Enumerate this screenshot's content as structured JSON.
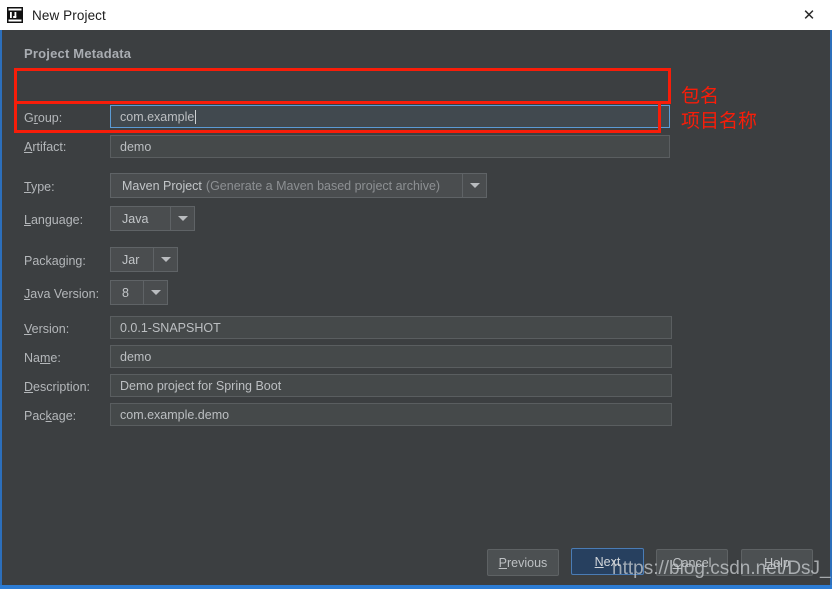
{
  "window": {
    "title": "New Project",
    "icon": "intellij-idea-icon",
    "close_label": "✕",
    "accent_border": "#2c6fbb",
    "background": "#3c3f41"
  },
  "section": {
    "title": "Project Metadata"
  },
  "form": {
    "group": {
      "label_pre": "G",
      "label_accel": "r",
      "label_post": "oup:",
      "label": "Group:",
      "value": "com.example",
      "focused": true
    },
    "artifact": {
      "label": "Artifact:",
      "label_pre": "",
      "label_accel": "A",
      "label_post": "rtifact:",
      "value": "demo",
      "focused": false
    },
    "type": {
      "label": "Type:",
      "label_pre": "",
      "label_accel": "T",
      "label_post": "ype:",
      "value": "Maven Project",
      "value_detail": "(Generate a Maven based project archive)"
    },
    "language": {
      "label": "Language:",
      "label_pre": "",
      "label_accel": "L",
      "label_post": "anguage:",
      "value": "Java"
    },
    "packaging": {
      "label": "Packaging:",
      "label_pre": "Packa",
      "label_accel": "g",
      "label_post": "ing:",
      "value": "Jar"
    },
    "java_version": {
      "label": "Java Version:",
      "label_pre": "",
      "label_accel": "J",
      "label_post": "ava Version:",
      "value": "8"
    },
    "version": {
      "label": "Version:",
      "label_pre": "",
      "label_accel": "V",
      "label_post": "ersion:",
      "value": "0.0.1-SNAPSHOT"
    },
    "name": {
      "label": "Name:",
      "label_pre": "Na",
      "label_accel": "m",
      "label_post": "e:",
      "value": "demo"
    },
    "description": {
      "label": "Description:",
      "label_pre": "",
      "label_accel": "D",
      "label_post": "escription:",
      "value": "Demo project for Spring Boot"
    },
    "package": {
      "label": "Package:",
      "label_pre": "Pac",
      "label_accel": "k",
      "label_post": "age:",
      "value": "com.example.demo"
    }
  },
  "annotations": {
    "color": "#f81d09",
    "group_note": "包名",
    "artifact_note": "项目名称"
  },
  "buttons": {
    "previous": {
      "label": "Previous",
      "pre": "",
      "accel": "P",
      "post": "revious"
    },
    "next": {
      "label": "Next",
      "pre": "",
      "accel": "N",
      "post": "ext",
      "primary": true
    },
    "cancel": {
      "label": "Cancel",
      "pre": "",
      "accel": "C",
      "post": "ancel"
    },
    "help": {
      "label": "Help",
      "pre": "",
      "accel": "H",
      "post": "elp"
    }
  },
  "watermark": {
    "text": "https://blog.csdn.net/DsJ_Blog"
  }
}
